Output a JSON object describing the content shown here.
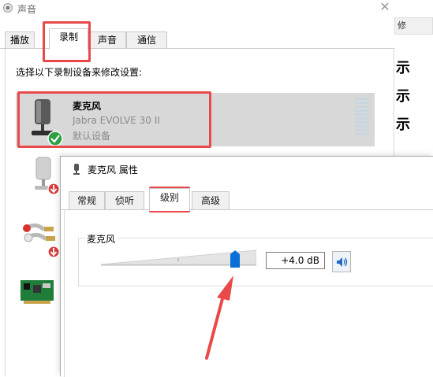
{
  "sound_dialog": {
    "title": "声音",
    "close_glyph": "✕",
    "tabs": [
      {
        "label": "播放"
      },
      {
        "label": "录制"
      },
      {
        "label": "声音"
      },
      {
        "label": "通信"
      }
    ],
    "instruction": "选择以下录制设备来修改设置:",
    "devices": [
      {
        "name": "麦克风",
        "model": "Jabra EVOLVE 30 II",
        "status": "默认设备"
      }
    ],
    "right_tab_partial": "修",
    "right_glyphs": [
      "示",
      "示",
      "示"
    ]
  },
  "properties_dialog": {
    "title": "麦克风 属性",
    "tabs": [
      {
        "label": "常规"
      },
      {
        "label": "侦听"
      },
      {
        "label": "级别"
      },
      {
        "label": "高级"
      }
    ],
    "group_label": "麦克风",
    "level_value": "+4.0 dB",
    "slider_level_fraction": 0.9
  },
  "colors": {
    "highlight": "#e84a4a",
    "accent": "#0a6fd6",
    "selected_row": "#d8d8d8"
  },
  "icons": [
    "speaker-icon",
    "microphone-icon",
    "green-check-icon",
    "red-down-arrow-icon",
    "line-in-icon",
    "sound-card-icon",
    "volume-icon"
  ]
}
